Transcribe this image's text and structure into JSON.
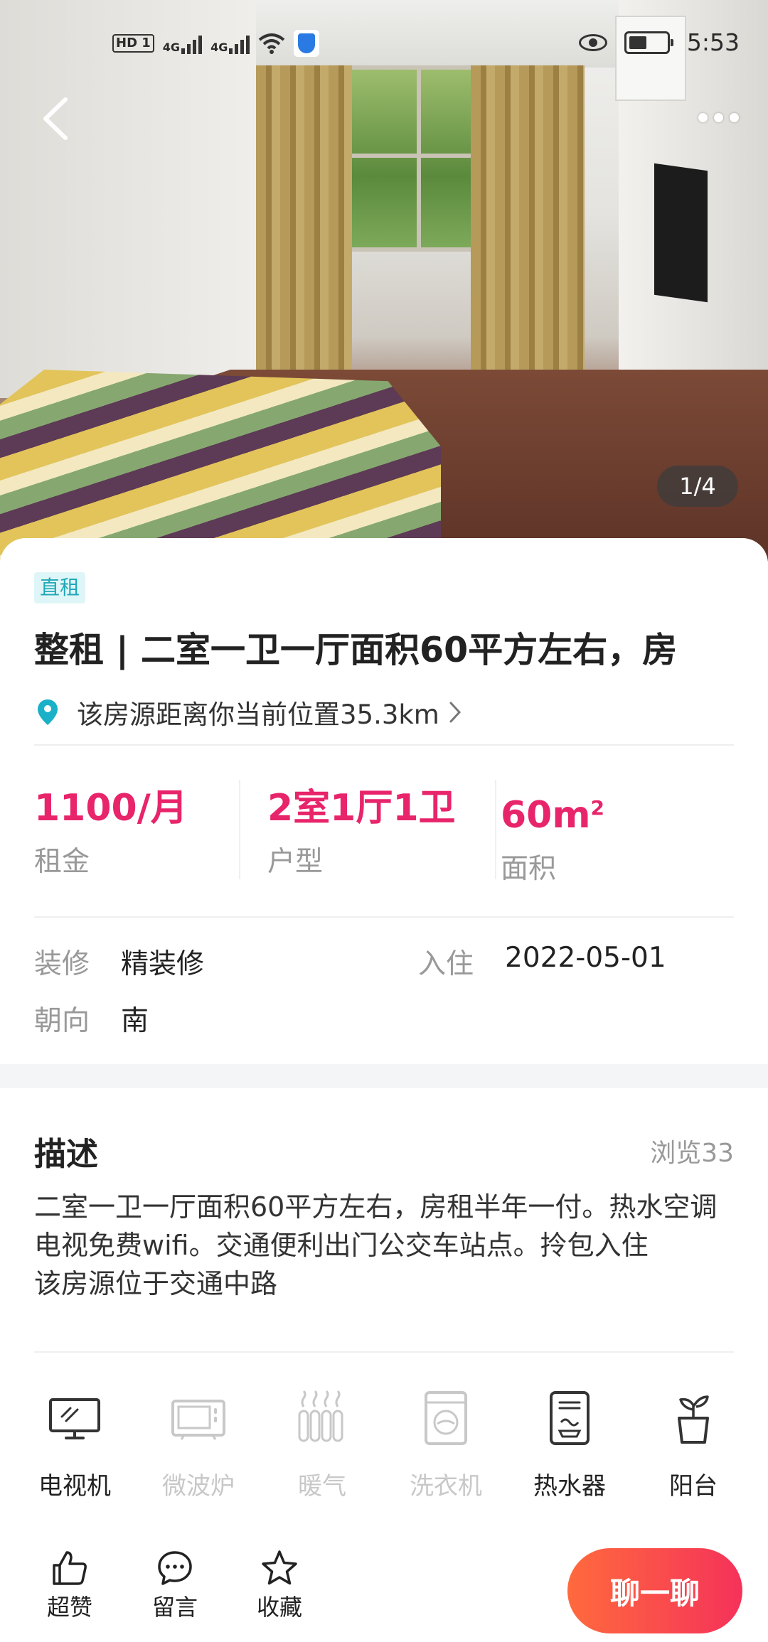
{
  "status_bar": {
    "hd_badge": "HD 1",
    "signal1": "4G",
    "signal2": "4G",
    "time": "5:53"
  },
  "gallery": {
    "counter": "1/4"
  },
  "listing": {
    "tag": "直租",
    "title": "整租 | 二室一卫一厅面积60平方左右，房",
    "location": "该房源距离你当前位置35.3km",
    "stats": [
      {
        "value": "1100/月",
        "label": "租金"
      },
      {
        "value": "2室1厅1卫",
        "label": "户型"
      },
      {
        "value": "60m",
        "value_sup": "2",
        "label": "面积"
      }
    ],
    "props": {
      "decor_key": "装修",
      "decor_val": "精装修",
      "move_key": "入住",
      "move_val": "2022-05-01",
      "facing_key": "朝向",
      "facing_val": "南"
    }
  },
  "description": {
    "heading": "描述",
    "views": "浏览33",
    "body": "二室一卫一厅面积60平方左右，房租半年一付。热水空调电视免费wifi。交通便利出门公交车站点。拎包入住\n该房源位于交通中路"
  },
  "amenities": [
    {
      "label": "电视机",
      "icon": "tv-icon",
      "available": true
    },
    {
      "label": "微波炉",
      "icon": "microwave-icon",
      "available": false
    },
    {
      "label": "暖气",
      "icon": "heater-icon",
      "available": false
    },
    {
      "label": "洗衣机",
      "icon": "washer-icon",
      "available": false
    },
    {
      "label": "热水器",
      "icon": "water-heater-icon",
      "available": true
    },
    {
      "label": "阳台",
      "icon": "balcony-plant-icon",
      "available": true
    }
  ],
  "bottom_bar": {
    "like": "超赞",
    "comment": "留言",
    "favorite": "收藏",
    "chat": "聊一聊"
  },
  "colors": {
    "accent": "#e8246b",
    "tag_bg": "#dff6f8",
    "tag_text": "#1fa7b8",
    "chat_start": "#ff6a3d",
    "chat_end": "#f5325a"
  }
}
